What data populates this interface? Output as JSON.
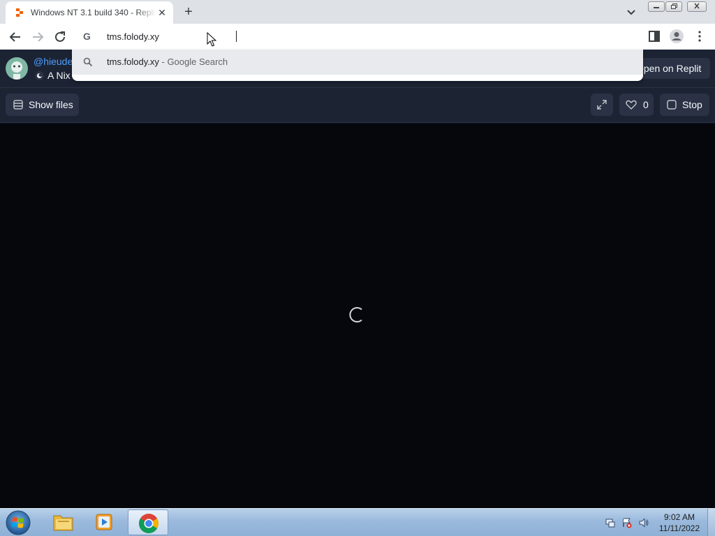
{
  "browser": {
    "tab": {
      "title": "Windows NT 3.1 build 340 - Replit",
      "favicon": "replit-icon"
    },
    "address_bar": {
      "value": "tms.folody.xy"
    },
    "suggestion": {
      "query": "tms.folody.xy",
      "hint": " - Google Search"
    }
  },
  "replit": {
    "header": {
      "user_handle": "@hieude",
      "repl_title": "A Nix",
      "open_button": "Open on Replit"
    },
    "actions": {
      "show_files_label": "Show files",
      "like_count": "0",
      "stop_label": "Stop"
    }
  },
  "taskbar": {
    "clock": {
      "time": "9:02 AM",
      "date": "11/11/2022"
    },
    "pinned": [
      "explorer",
      "media-player",
      "chrome"
    ]
  },
  "colors": {
    "replit_bg": "#1c2333",
    "replit_button": "#2b3245",
    "replit_link": "#4e9eff",
    "output_bg": "#05070c"
  }
}
